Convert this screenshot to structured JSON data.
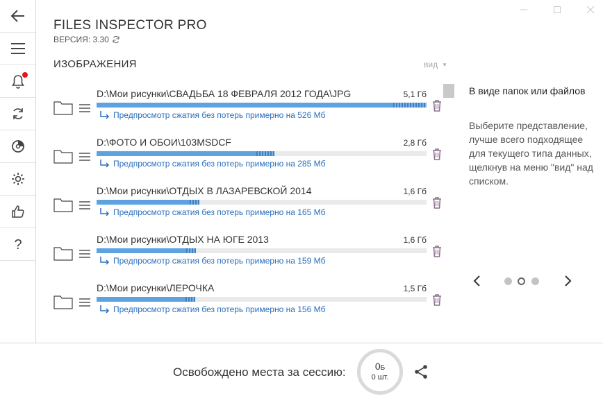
{
  "app": {
    "title": "FILES INSPECTOR PRO",
    "version": "ВЕРСИЯ: 3.30"
  },
  "sidebar": {
    "items": [
      {
        "icon": "back-arrow-icon"
      },
      {
        "icon": "hamburger-menu-icon"
      },
      {
        "icon": "bell-icon",
        "badge": true
      },
      {
        "icon": "refresh-icon"
      },
      {
        "icon": "disk-icon"
      },
      {
        "icon": "gear-icon"
      },
      {
        "icon": "thumbs-up-icon"
      },
      {
        "icon": "help-icon",
        "label": "?"
      }
    ]
  },
  "section": {
    "title": "ИЗОБРАЖЕНИЯ",
    "view_label": "вид"
  },
  "items": [
    {
      "path": "D:\\Мои рисунки\\СВАДЬБА 18 ФЕВРАЛЯ 2012 ГОДА\\JPG",
      "size": "5,1 Гб",
      "preview": "Предпросмотр сжатия без потерь примерно на 526 Мб",
      "fill": 1.0,
      "hatch": 0.1
    },
    {
      "path": "D:\\ФОТО И ОБОИ\\103MSDCF",
      "size": "2,8 Гб",
      "preview": "Предпросмотр сжатия без потерь примерно на 285 Мб",
      "fill": 0.538,
      "hatch": 0.055
    },
    {
      "path": "D:\\Мои рисунки\\ОТДЫХ В ЛАЗАРЕВСКОЙ 2014",
      "size": "1,6 Гб",
      "preview": "Предпросмотр сжатия без потерь примерно на 165 Мб",
      "fill": 0.312,
      "hatch": 0.03
    },
    {
      "path": "D:\\Мои рисунки\\ОТДЫХ НА ЮГЕ 2013",
      "size": "1,6 Гб",
      "preview": "Предпросмотр сжатия без потерь примерно на 159 Мб",
      "fill": 0.302,
      "hatch": 0.03
    },
    {
      "path": "D:\\Мои рисунки\\ЛЕРОЧКА",
      "size": "1,5 Гб",
      "preview": "Предпросмотр сжатия без потерь примерно на 156 Мб",
      "fill": 0.298,
      "hatch": 0.03
    }
  ],
  "tip": {
    "title": "В виде папок или файлов",
    "text": "Выберите представление, лучше всего подходящее для текущего типа данных, щелкнув на меню \"вид\" над списком.",
    "page_count": 3,
    "active_page": 1
  },
  "footer": {
    "label": "Освобождено места за сессию:",
    "freed_value": "0",
    "freed_unit": "Б",
    "freed_count": "0 шт."
  },
  "colors": {
    "accent": "#5da3e2",
    "link": "#2a6ebd",
    "notification": "#e8141b",
    "trash": "#8a6f8c"
  }
}
